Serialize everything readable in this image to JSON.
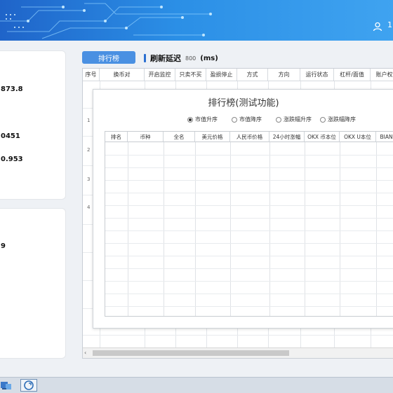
{
  "header": {
    "user_text": "1"
  },
  "stats": {
    "card1": [
      "873.8",
      "0451",
      "0.953"
    ],
    "card2": [
      "9"
    ]
  },
  "toolbar": {
    "rank_button": "排行榜",
    "refresh_label": "刷新延迟",
    "refresh_value": "800",
    "refresh_unit": "(ms)"
  },
  "grid": {
    "columns": [
      "序号",
      "换币对",
      "开启监控",
      "只卖不买",
      "盈损停止",
      "方式",
      "方向",
      "运行状态",
      "杠杆/面值",
      "账户权"
    ],
    "row_numbers": [
      "1",
      "2",
      "3",
      "4"
    ]
  },
  "dialog": {
    "title": "排行榜(测试功能)",
    "sort_options": [
      {
        "label": "市值升序",
        "checked": true
      },
      {
        "label": "市值降序",
        "checked": false
      },
      {
        "label": "涨跌幅升序",
        "checked": false
      },
      {
        "label": "涨跌幅降序",
        "checked": false
      }
    ],
    "columns": [
      "排名",
      "币种",
      "全名",
      "美元价格",
      "人民币价格",
      "24小时涨幅",
      "OKX 币本位",
      "OKX U本位",
      "BIAN 币"
    ]
  },
  "colors": {
    "accent": "#4a90e2",
    "header_gradient_start": "#1f64c9",
    "header_gradient_end": "#3fa3f0"
  }
}
